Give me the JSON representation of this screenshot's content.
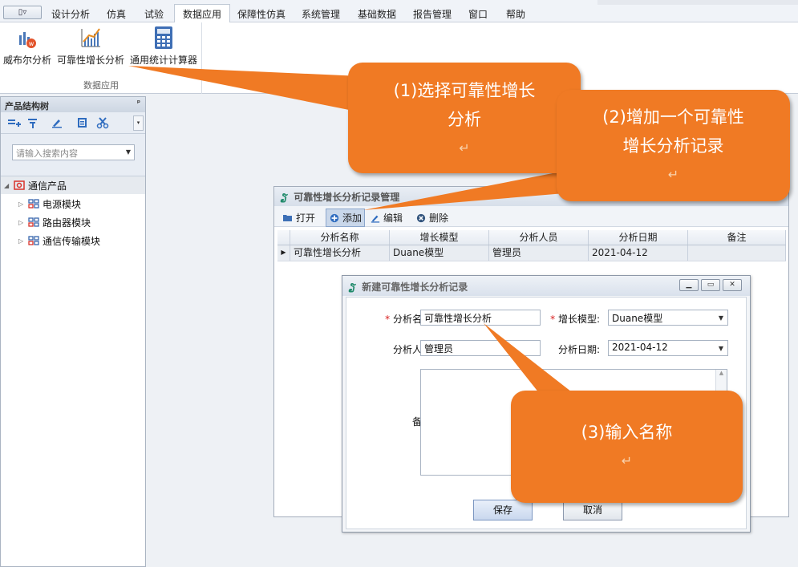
{
  "menubar": {
    "menu_button": "▯▿",
    "items": [
      "设计分析",
      "仿真",
      "试验",
      "数据应用",
      "保障性仿真",
      "系统管理",
      "基础数据",
      "报告管理",
      "窗口",
      "帮助"
    ],
    "active_index": 3
  },
  "ribbon": {
    "buttons": [
      "威布尔分析",
      "可靠性增长分析",
      "通用统计计算器"
    ],
    "group_label": "数据应用"
  },
  "left_panel": {
    "title": "产品结构树",
    "pin": "ᵖ",
    "search_placeholder": "请输入搜索内容",
    "tree": {
      "root": "通信产品",
      "children": [
        "电源模块",
        "路由器模块",
        "通信传输模块"
      ]
    }
  },
  "record_manager": {
    "title": "可靠性增长分析记录管理",
    "toolbar": [
      "打开",
      "添加",
      "编辑",
      "删除"
    ],
    "columns": [
      "分析名称",
      "增长模型",
      "分析人员",
      "分析日期",
      "备注"
    ],
    "rows": [
      {
        "name": "可靠性增长分析",
        "model": "Duane模型",
        "analyst": "管理员",
        "date": "2021-04-12",
        "note": ""
      }
    ]
  },
  "dialog": {
    "title": "新建可靠性增长分析记录",
    "required_mark": "*",
    "fields": {
      "name_label": "分析名称:",
      "name_value": "可靠性增长分析",
      "model_label": "增长模型:",
      "model_value": "Duane模型",
      "analyst_label": "分析人员:",
      "analyst_value": "管理员",
      "date_label": "分析日期:",
      "date_value": "2021-04-12",
      "note_label": "备注:"
    },
    "save": "保存",
    "cancel": "取消"
  },
  "callouts": {
    "c1_line1": "(1)选择可靠性增长",
    "c1_line2": "分析",
    "c2_line1": "(2)增加一个可靠性",
    "c2_line2": "增长分析记录",
    "c3": "(3)输入名称",
    "return_mark": "↵"
  },
  "colors": {
    "callout": "#f07a24",
    "required": "#d81e1e",
    "accent": "#2f6cbf"
  }
}
